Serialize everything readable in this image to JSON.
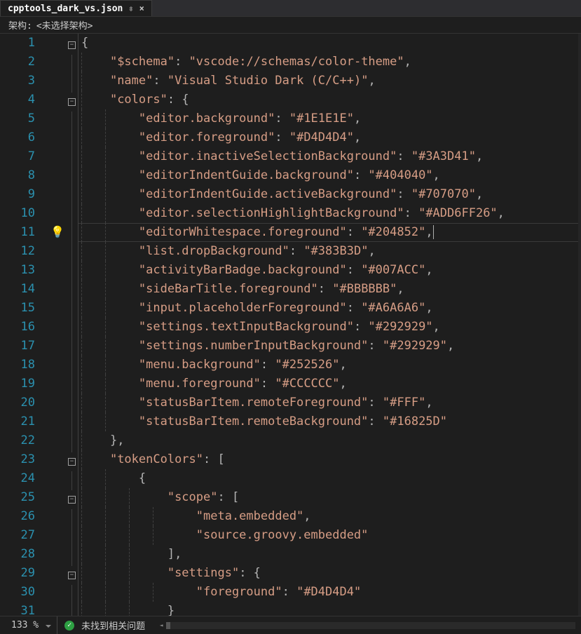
{
  "tab": {
    "filename": "cpptools_dark_vs.json",
    "pin": "⇳",
    "close": "×"
  },
  "breadcrumb": {
    "label": "架构:",
    "value": "<未选择架构>"
  },
  "fold_states": [
    "box",
    "line",
    "line",
    "box",
    "line",
    "line",
    "line",
    "line",
    "line",
    "line",
    "line",
    "line",
    "line",
    "line",
    "line",
    "line",
    "line",
    "line",
    "line",
    "line",
    "line",
    "line",
    "box",
    "line",
    "box",
    "line",
    "line",
    "line",
    "box",
    "line",
    "line"
  ],
  "lines": [
    {
      "n": 1,
      "guides": [],
      "tokens": [
        {
          "c": "b",
          "t": "{"
        }
      ]
    },
    {
      "n": 2,
      "guides": [
        "g1"
      ],
      "tokens": [
        {
          "c": "p",
          "t": "    "
        },
        {
          "c": "s",
          "t": "\"$schema\""
        },
        {
          "c": "p",
          "t": ": "
        },
        {
          "c": "s",
          "t": "\"vscode://schemas/color-theme\""
        },
        {
          "c": "p",
          "t": ","
        }
      ]
    },
    {
      "n": 3,
      "guides": [
        "g1"
      ],
      "tokens": [
        {
          "c": "p",
          "t": "    "
        },
        {
          "c": "s",
          "t": "\"name\""
        },
        {
          "c": "p",
          "t": ": "
        },
        {
          "c": "s",
          "t": "\"Visual Studio Dark (C/C++)\""
        },
        {
          "c": "p",
          "t": ","
        }
      ]
    },
    {
      "n": 4,
      "guides": [
        "g1"
      ],
      "tokens": [
        {
          "c": "p",
          "t": "    "
        },
        {
          "c": "s",
          "t": "\"colors\""
        },
        {
          "c": "p",
          "t": ": "
        },
        {
          "c": "b",
          "t": "{"
        }
      ]
    },
    {
      "n": 5,
      "guides": [
        "g1",
        "g2"
      ],
      "tokens": [
        {
          "c": "p",
          "t": "        "
        },
        {
          "c": "s",
          "t": "\"editor.background\""
        },
        {
          "c": "p",
          "t": ": "
        },
        {
          "c": "s",
          "t": "\"#1E1E1E\""
        },
        {
          "c": "p",
          "t": ","
        }
      ]
    },
    {
      "n": 6,
      "guides": [
        "g1",
        "g2"
      ],
      "tokens": [
        {
          "c": "p",
          "t": "        "
        },
        {
          "c": "s",
          "t": "\"editor.foreground\""
        },
        {
          "c": "p",
          "t": ": "
        },
        {
          "c": "s",
          "t": "\"#D4D4D4\""
        },
        {
          "c": "p",
          "t": ","
        }
      ]
    },
    {
      "n": 7,
      "guides": [
        "g1",
        "g2"
      ],
      "tokens": [
        {
          "c": "p",
          "t": "        "
        },
        {
          "c": "s",
          "t": "\"editor.inactiveSelectionBackground\""
        },
        {
          "c": "p",
          "t": ": "
        },
        {
          "c": "s",
          "t": "\"#3A3D41\""
        },
        {
          "c": "p",
          "t": ","
        }
      ]
    },
    {
      "n": 8,
      "guides": [
        "g1",
        "g2"
      ],
      "tokens": [
        {
          "c": "p",
          "t": "        "
        },
        {
          "c": "s",
          "t": "\"editorIndentGuide.background\""
        },
        {
          "c": "p",
          "t": ": "
        },
        {
          "c": "s",
          "t": "\"#404040\""
        },
        {
          "c": "p",
          "t": ","
        }
      ]
    },
    {
      "n": 9,
      "guides": [
        "g1",
        "g2"
      ],
      "tokens": [
        {
          "c": "p",
          "t": "        "
        },
        {
          "c": "s",
          "t": "\"editorIndentGuide.activeBackground\""
        },
        {
          "c": "p",
          "t": ": "
        },
        {
          "c": "s",
          "t": "\"#707070\""
        },
        {
          "c": "p",
          "t": ","
        }
      ]
    },
    {
      "n": 10,
      "guides": [
        "g1",
        "g2"
      ],
      "tokens": [
        {
          "c": "p",
          "t": "        "
        },
        {
          "c": "s",
          "t": "\"editor.selectionHighlightBackground\""
        },
        {
          "c": "p",
          "t": ": "
        },
        {
          "c": "s",
          "t": "\"#ADD6FF26\""
        },
        {
          "c": "p",
          "t": ","
        }
      ]
    },
    {
      "n": 11,
      "guides": [
        "g1",
        "g2"
      ],
      "highlight": true,
      "tokens": [
        {
          "c": "p",
          "t": "        "
        },
        {
          "c": "s",
          "t": "\"editorWhitespace.foreground\""
        },
        {
          "c": "p",
          "t": ": "
        },
        {
          "c": "s",
          "t": "\"#204852\""
        },
        {
          "c": "p",
          "t": ","
        },
        {
          "cursor": true
        }
      ]
    },
    {
      "n": 12,
      "guides": [
        "g1",
        "g2"
      ],
      "tokens": [
        {
          "c": "p",
          "t": "        "
        },
        {
          "c": "s",
          "t": "\"list.dropBackground\""
        },
        {
          "c": "p",
          "t": ": "
        },
        {
          "c": "s",
          "t": "\"#383B3D\""
        },
        {
          "c": "p",
          "t": ","
        }
      ]
    },
    {
      "n": 13,
      "guides": [
        "g1",
        "g2"
      ],
      "tokens": [
        {
          "c": "p",
          "t": "        "
        },
        {
          "c": "s",
          "t": "\"activityBarBadge.background\""
        },
        {
          "c": "p",
          "t": ": "
        },
        {
          "c": "s",
          "t": "\"#007ACC\""
        },
        {
          "c": "p",
          "t": ","
        }
      ]
    },
    {
      "n": 14,
      "guides": [
        "g1",
        "g2"
      ],
      "tokens": [
        {
          "c": "p",
          "t": "        "
        },
        {
          "c": "s",
          "t": "\"sideBarTitle.foreground\""
        },
        {
          "c": "p",
          "t": ": "
        },
        {
          "c": "s",
          "t": "\"#BBBBBB\""
        },
        {
          "c": "p",
          "t": ","
        }
      ]
    },
    {
      "n": 15,
      "guides": [
        "g1",
        "g2"
      ],
      "tokens": [
        {
          "c": "p",
          "t": "        "
        },
        {
          "c": "s",
          "t": "\"input.placeholderForeground\""
        },
        {
          "c": "p",
          "t": ": "
        },
        {
          "c": "s",
          "t": "\"#A6A6A6\""
        },
        {
          "c": "p",
          "t": ","
        }
      ]
    },
    {
      "n": 16,
      "guides": [
        "g1",
        "g2"
      ],
      "tokens": [
        {
          "c": "p",
          "t": "        "
        },
        {
          "c": "s",
          "t": "\"settings.textInputBackground\""
        },
        {
          "c": "p",
          "t": ": "
        },
        {
          "c": "s",
          "t": "\"#292929\""
        },
        {
          "c": "p",
          "t": ","
        }
      ]
    },
    {
      "n": 17,
      "guides": [
        "g1",
        "g2"
      ],
      "tokens": [
        {
          "c": "p",
          "t": "        "
        },
        {
          "c": "s",
          "t": "\"settings.numberInputBackground\""
        },
        {
          "c": "p",
          "t": ": "
        },
        {
          "c": "s",
          "t": "\"#292929\""
        },
        {
          "c": "p",
          "t": ","
        }
      ]
    },
    {
      "n": 18,
      "guides": [
        "g1",
        "g2"
      ],
      "tokens": [
        {
          "c": "p",
          "t": "        "
        },
        {
          "c": "s",
          "t": "\"menu.background\""
        },
        {
          "c": "p",
          "t": ": "
        },
        {
          "c": "s",
          "t": "\"#252526\""
        },
        {
          "c": "p",
          "t": ","
        }
      ]
    },
    {
      "n": 19,
      "guides": [
        "g1",
        "g2"
      ],
      "tokens": [
        {
          "c": "p",
          "t": "        "
        },
        {
          "c": "s",
          "t": "\"menu.foreground\""
        },
        {
          "c": "p",
          "t": ": "
        },
        {
          "c": "s",
          "t": "\"#CCCCCC\""
        },
        {
          "c": "p",
          "t": ","
        }
      ]
    },
    {
      "n": 20,
      "guides": [
        "g1",
        "g2"
      ],
      "tokens": [
        {
          "c": "p",
          "t": "        "
        },
        {
          "c": "s",
          "t": "\"statusBarItem.remoteForeground\""
        },
        {
          "c": "p",
          "t": ": "
        },
        {
          "c": "s",
          "t": "\"#FFF\""
        },
        {
          "c": "p",
          "t": ","
        }
      ]
    },
    {
      "n": 21,
      "guides": [
        "g1",
        "g2"
      ],
      "tokens": [
        {
          "c": "p",
          "t": "        "
        },
        {
          "c": "s",
          "t": "\"statusBarItem.remoteBackground\""
        },
        {
          "c": "p",
          "t": ": "
        },
        {
          "c": "s",
          "t": "\"#16825D\""
        }
      ]
    },
    {
      "n": 22,
      "guides": [
        "g1"
      ],
      "tokens": [
        {
          "c": "p",
          "t": "    "
        },
        {
          "c": "b",
          "t": "}"
        },
        {
          "c": "p",
          "t": ","
        }
      ]
    },
    {
      "n": 23,
      "guides": [
        "g1"
      ],
      "tokens": [
        {
          "c": "p",
          "t": "    "
        },
        {
          "c": "s",
          "t": "\"tokenColors\""
        },
        {
          "c": "p",
          "t": ": "
        },
        {
          "c": "b",
          "t": "["
        }
      ]
    },
    {
      "n": 24,
      "guides": [
        "g1",
        "g2"
      ],
      "tokens": [
        {
          "c": "p",
          "t": "        "
        },
        {
          "c": "b",
          "t": "{"
        }
      ]
    },
    {
      "n": 25,
      "guides": [
        "g1",
        "g2",
        "g3"
      ],
      "tokens": [
        {
          "c": "p",
          "t": "            "
        },
        {
          "c": "s",
          "t": "\"scope\""
        },
        {
          "c": "p",
          "t": ": "
        },
        {
          "c": "b",
          "t": "["
        }
      ]
    },
    {
      "n": 26,
      "guides": [
        "g1",
        "g2",
        "g3",
        "g4"
      ],
      "tokens": [
        {
          "c": "p",
          "t": "                "
        },
        {
          "c": "s",
          "t": "\"meta.embedded\""
        },
        {
          "c": "p",
          "t": ","
        }
      ]
    },
    {
      "n": 27,
      "guides": [
        "g1",
        "g2",
        "g3",
        "g4"
      ],
      "tokens": [
        {
          "c": "p",
          "t": "                "
        },
        {
          "c": "s",
          "t": "\"source.groovy.embedded\""
        }
      ]
    },
    {
      "n": 28,
      "guides": [
        "g1",
        "g2",
        "g3"
      ],
      "tokens": [
        {
          "c": "p",
          "t": "            "
        },
        {
          "c": "b",
          "t": "]"
        },
        {
          "c": "p",
          "t": ","
        }
      ]
    },
    {
      "n": 29,
      "guides": [
        "g1",
        "g2",
        "g3"
      ],
      "tokens": [
        {
          "c": "p",
          "t": "            "
        },
        {
          "c": "s",
          "t": "\"settings\""
        },
        {
          "c": "p",
          "t": ": "
        },
        {
          "c": "b",
          "t": "{"
        }
      ]
    },
    {
      "n": 30,
      "guides": [
        "g1",
        "g2",
        "g3",
        "g4"
      ],
      "tokens": [
        {
          "c": "p",
          "t": "                "
        },
        {
          "c": "s",
          "t": "\"foreground\""
        },
        {
          "c": "p",
          "t": ": "
        },
        {
          "c": "s",
          "t": "\"#D4D4D4\""
        }
      ]
    },
    {
      "n": 31,
      "guides": [
        "g1",
        "g2",
        "g3"
      ],
      "tokens": [
        {
          "c": "p",
          "t": "            "
        },
        {
          "c": "b",
          "t": "}"
        }
      ]
    }
  ],
  "status": {
    "zoom": "133 %",
    "check_msg": "未找到相关问题"
  }
}
